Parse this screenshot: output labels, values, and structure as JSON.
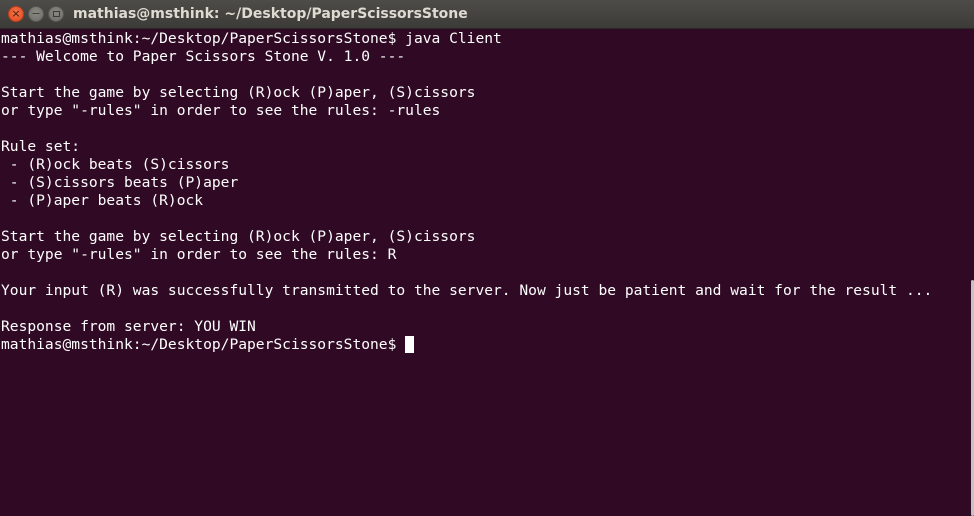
{
  "window": {
    "title": "mathias@msthink: ~/Desktop/PaperScissorsStone",
    "close_glyph": "×",
    "minimize_glyph": "−"
  },
  "terminal": {
    "lines": [
      "mathias@msthink:~/Desktop/PaperScissorsStone$ java Client",
      "--- Welcome to Paper Scissors Stone V. 1.0 ---",
      "",
      "Start the game by selecting (R)ock (P)aper, (S)cissors",
      "or type \"-rules\" in order to see the rules: -rules",
      "",
      "Rule set:",
      " - (R)ock beats (S)cissors",
      " - (S)cissors beats (P)aper",
      " - (P)aper beats (R)ock",
      "",
      "Start the game by selecting (R)ock (P)aper, (S)cissors",
      "or type \"-rules\" in order to see the rules: R",
      "",
      "Your input (R) was successfully transmitted to the server. Now just be patient and wait for the result ...",
      "",
      "Response from server: YOU WIN"
    ],
    "prompt": "mathias@msthink:~/Desktop/PaperScissorsStone$"
  },
  "colors": {
    "background": "#300a24",
    "text": "#ffffff",
    "titlebar": "#3c3b37",
    "close_button": "#e0481d"
  }
}
